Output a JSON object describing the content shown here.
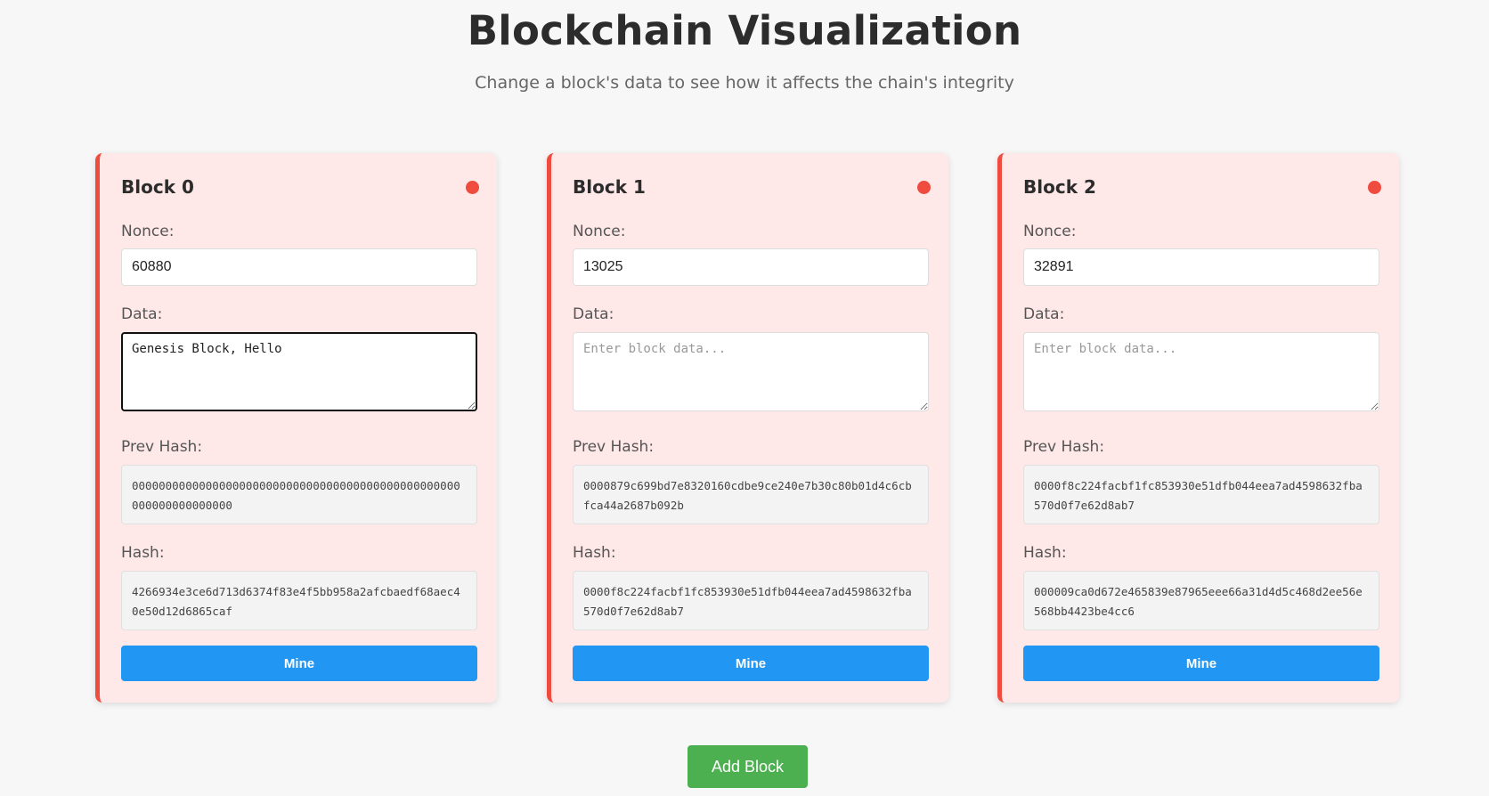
{
  "header": {
    "title": "Blockchain Visualization",
    "subtitle": "Change a block's data to see how it affects the chain's integrity"
  },
  "labels": {
    "nonce": "Nonce:",
    "data": "Data:",
    "prev_hash": "Prev Hash:",
    "hash": "Hash:",
    "mine": "Mine",
    "data_placeholder": "Enter block data..."
  },
  "blocks": [
    {
      "title": "Block 0",
      "status": "invalid",
      "status_color": "#ef4b3f",
      "nonce": "60880",
      "data": "Genesis Block, Hello",
      "prev_hash": "0000000000000000000000000000000000000000000000000000000000000000",
      "hash": "4266934e3ce6d713d6374f83e4f5bb958a2afcbaedf68aec40e50d12d6865caf"
    },
    {
      "title": "Block 1",
      "status": "invalid",
      "status_color": "#ef4b3f",
      "nonce": "13025",
      "data": "",
      "prev_hash": "0000879c699bd7e8320160cdbe9ce240e7b30c80b01d4c6cbfca44a2687b092b",
      "hash": "0000f8c224facbf1fc853930e51dfb044eea7ad4598632fba570d0f7e62d8ab7"
    },
    {
      "title": "Block 2",
      "status": "invalid",
      "status_color": "#ef4b3f",
      "nonce": "32891",
      "data": "",
      "prev_hash": "0000f8c224facbf1fc853930e51dfb044eea7ad4598632fba570d0f7e62d8ab7",
      "hash": "000009ca0d672e465839e87965eee66a31d4d5c468d2ee56e568bb4423be4cc6"
    }
  ],
  "actions": {
    "add_block": "Add Block"
  },
  "colors": {
    "invalid_block_bg": "#ffe8e8",
    "invalid_accent": "#ef4b3f",
    "mine_button": "#2196f3",
    "add_button": "#4caf50"
  }
}
